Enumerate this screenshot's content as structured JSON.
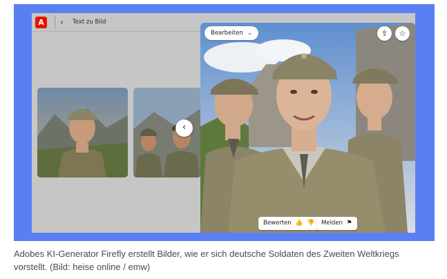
{
  "app": {
    "logo_letter": "A",
    "back_icon": "chevron-left-icon",
    "title": "Text zu Bild"
  },
  "viewer": {
    "edit_label": "Bearbeiten",
    "edit_icon": "chevron-down-icon",
    "share_icon": "share-icon",
    "favorite_icon": "star-icon",
    "prev_icon": "chevron-left-icon",
    "rate_label": "Bewerten",
    "rate_icons": [
      "thumbs-up-icon",
      "thumbs-down-icon"
    ],
    "report_label": "Melden",
    "report_icon": "flag-icon"
  },
  "colors": {
    "frame": "#5a7ff5",
    "adobe_red": "#eb1000",
    "uniform": "#8b8466"
  },
  "caption": {
    "text": "Adobes KI-Generator Firefly erstellt Bilder, wie er sich deutsche Soldaten des Zweiten Weltkriegs vorstellt. (Bild: heise online / emw)"
  }
}
